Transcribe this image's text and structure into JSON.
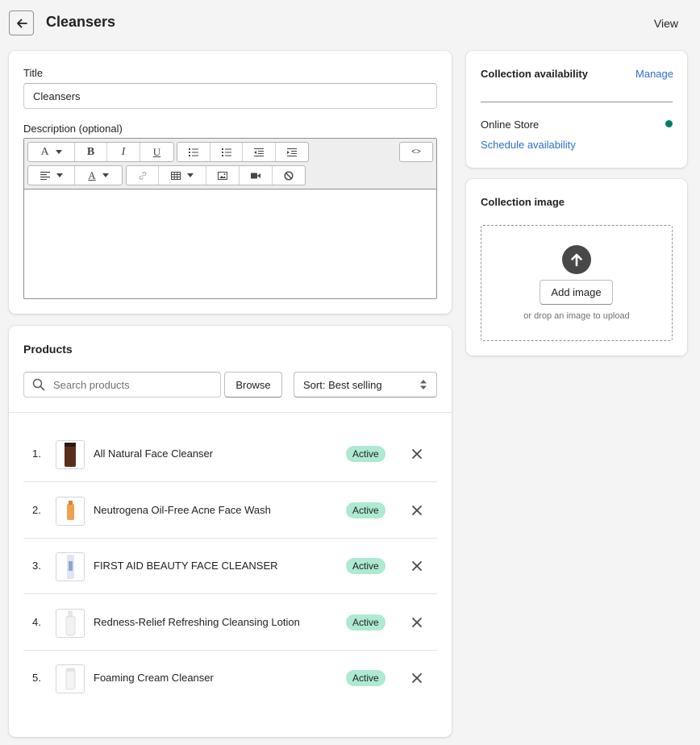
{
  "header": {
    "title": "Cleansers",
    "view_label": "View"
  },
  "details": {
    "title_label": "Title",
    "title_value": "Cleansers",
    "description_label": "Description (optional)"
  },
  "editor": {
    "toolbar_row1": [
      "font-icon",
      "bold-icon",
      "italic-icon",
      "underline-icon",
      "bullet-list-icon",
      "numbered-list-icon",
      "outdent-icon",
      "indent-icon",
      "html-source-icon"
    ],
    "toolbar_row2": [
      "align-icon",
      "text-color-icon",
      "link-icon",
      "table-icon",
      "image-icon",
      "video-icon",
      "clear-format-icon"
    ],
    "html_label": "<>"
  },
  "products": {
    "title": "Products",
    "search_placeholder": "Search products",
    "browse_label": "Browse",
    "sort_label": "Sort: Best selling",
    "items": [
      {
        "num": "1.",
        "name": "All Natural Face Cleanser",
        "status": "Active"
      },
      {
        "num": "2.",
        "name": "Neutrogena Oil-Free Acne Face Wash",
        "status": "Active"
      },
      {
        "num": "3.",
        "name": "FIRST AID BEAUTY FACE CLEANSER",
        "status": "Active"
      },
      {
        "num": "4.",
        "name": "Redness-Relief Refreshing Cleansing Lotion",
        "status": "Active"
      },
      {
        "num": "5.",
        "name": "Foaming Cream Cleanser",
        "status": "Active"
      }
    ]
  },
  "availability": {
    "title": "Collection availability",
    "manage_label": "Manage",
    "channel": "Online Store",
    "schedule_label": "Schedule availability",
    "status_color": "#007f5f"
  },
  "collection_image": {
    "title": "Collection image",
    "add_label": "Add image",
    "hint": "or drop an image to upload"
  },
  "colors": {
    "badge_active": "#aee9d1",
    "link": "#2c6ecb"
  }
}
